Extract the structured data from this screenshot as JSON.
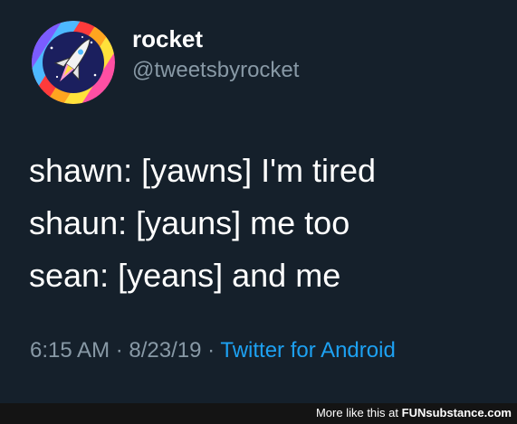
{
  "tweet": {
    "author": {
      "display_name": "rocket",
      "handle": "@tweetsbyrocket",
      "avatar_icon": "space-shuttle-rainbow-icon"
    },
    "lines": [
      "shawn: [yawns] I'm tired",
      "shaun: [yauns] me too",
      "sean: [yeans] and me"
    ],
    "meta": {
      "time": "6:15 AM",
      "separator": " · ",
      "date": "8/23/19",
      "source": "Twitter for Android"
    }
  },
  "footer": {
    "text": "More like this at ",
    "brand": "FUNsubstance.com"
  },
  "colors": {
    "background": "#15202b",
    "text": "#ffffff",
    "secondary": "#8899a6",
    "link": "#1da1f2",
    "footer_bg": "#141414"
  }
}
